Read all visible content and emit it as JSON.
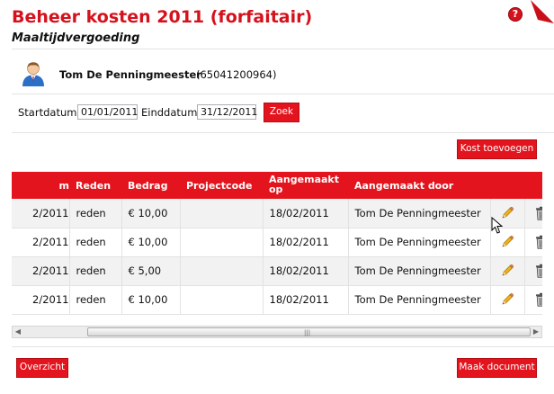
{
  "header": {
    "title": "Beheer kosten 2011 (forfaitair)",
    "subtitle": "Maaltijdvergoeding",
    "help_glyph": "?"
  },
  "user": {
    "name": "Tom De Penningmeester",
    "id": "(65041200964)"
  },
  "search": {
    "start_label": "Startdatum",
    "start_value": "01/01/2011",
    "end_label": "Einddatum",
    "end_value": "31/12/2011",
    "search_button": "Zoek"
  },
  "actions": {
    "add_cost": "Kost toevoegen",
    "overview": "Overzicht",
    "make_document": "Maak document"
  },
  "table": {
    "columns": [
      "m",
      "Reden",
      "Bedrag",
      "Projectcode",
      "Aangemaakt op",
      "Aangemaakt door"
    ],
    "column_1_line1": "Aangemaakt",
    "column_1_line2": "op",
    "rows": [
      {
        "date": "2/2011",
        "reason": "reden",
        "amount": "€ 10,00",
        "project": "",
        "created_on": "18/02/2011",
        "created_by": "Tom De Penningmeester"
      },
      {
        "date": "2/2011",
        "reason": "reden",
        "amount": "€ 10,00",
        "project": "",
        "created_on": "18/02/2011",
        "created_by": "Tom De Penningmeester"
      },
      {
        "date": "2/2011",
        "reason": "reden",
        "amount": "€ 5,00",
        "project": "",
        "created_on": "18/02/2011",
        "created_by": "Tom De Penningmeester"
      },
      {
        "date": "2/2011",
        "reason": "reden",
        "amount": "€ 10,00",
        "project": "",
        "created_on": "18/02/2011",
        "created_by": "Tom De Penningmeester"
      }
    ]
  },
  "scrollbar": {
    "left_arrow": "◀",
    "right_arrow": "▶",
    "grip": "|||"
  },
  "colors": {
    "accent": "#e3141d",
    "title": "#d5121c",
    "row_alt": "#f2f2f2"
  },
  "icons": [
    "help-icon",
    "user-avatar-icon",
    "edit-pencil-icon",
    "trash-icon",
    "mouse-cursor-icon"
  ]
}
